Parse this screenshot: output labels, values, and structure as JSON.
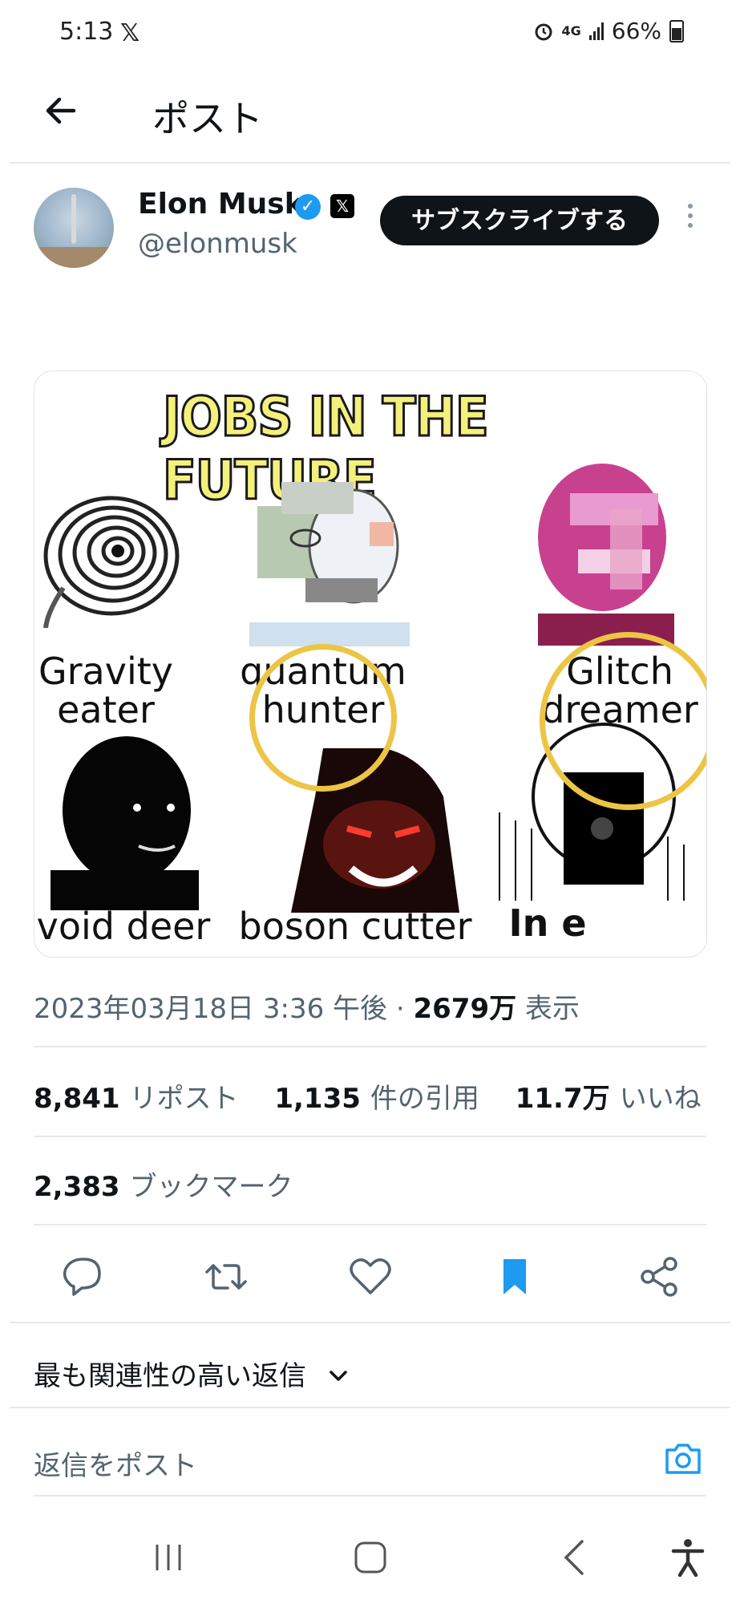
{
  "status_bar": {
    "time": "5:13",
    "app_glyph": "𝕏",
    "network": "4G",
    "battery": "66%"
  },
  "header": {
    "title": "ポスト"
  },
  "author": {
    "name": "Elon Musk",
    "handle": "@elonmusk",
    "subscribe_label": "サブスクライブする"
  },
  "media": {
    "title": "JOBS IN THE FUTURE",
    "labels": [
      "Gravity eater",
      "quantum hunter",
      "Glitch dreamer",
      "void deer",
      "boson cutter",
      "In e"
    ]
  },
  "post_meta": {
    "datetime": "2023年03月18日 3:36 午後",
    "separator": " · ",
    "views_count": "2679万",
    "views_label": "表示"
  },
  "stats": {
    "reposts_count": "8,841",
    "reposts_label": "リポスト",
    "quotes_count": "1,135",
    "quotes_label": "件の引用",
    "likes_count": "11.7万",
    "likes_label": "いいね",
    "bookmarks_count": "2,383",
    "bookmarks_label": "ブックマーク"
  },
  "replies": {
    "sort_label": "最も関連性の高い返信",
    "input_placeholder": "返信をポスト"
  },
  "colors": {
    "accent": "#1d9bf0",
    "text": "#0f1419",
    "muted": "#536471",
    "ring": "#ecc545"
  }
}
